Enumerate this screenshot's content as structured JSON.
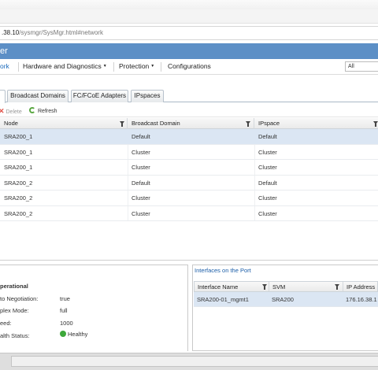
{
  "browser": {
    "url_host": ".38.10",
    "url_path": "/sysmgr/SysMgr.html#network"
  },
  "app": {
    "title": "er"
  },
  "menu": {
    "items": [
      {
        "label": "ork"
      },
      {
        "label": "Hardware and Diagnostics",
        "caret": "▼"
      },
      {
        "label": "Protection",
        "caret": "▼"
      },
      {
        "label": "Configurations"
      }
    ],
    "search_value": "All"
  },
  "tabs": [
    {
      "label": "Broadcast Domains"
    },
    {
      "label": "FC/FCoE Adapters"
    },
    {
      "label": "IPspaces"
    }
  ],
  "toolbar": {
    "delete_label": "Delete",
    "refresh_label": "Refresh"
  },
  "grid": {
    "columns": [
      "Node",
      "Broadcast Domain",
      "IPspace"
    ],
    "rows": [
      [
        "SRA200_1",
        "Default",
        "Default"
      ],
      [
        "SRA200_1",
        "Cluster",
        "Cluster"
      ],
      [
        "SRA200_1",
        "Cluster",
        "Cluster"
      ],
      [
        "SRA200_2",
        "Default",
        "Default"
      ],
      [
        "SRA200_2",
        "Cluster",
        "Cluster"
      ],
      [
        "SRA200_2",
        "Cluster",
        "Cluster"
      ]
    ]
  },
  "details": {
    "title": "perational",
    "fields": [
      {
        "label": "to Negotiation:",
        "value": "true"
      },
      {
        "label": "plex Mode:",
        "value": "full"
      },
      {
        "label": "eed:",
        "value": "1000"
      },
      {
        "label": "alth Status:",
        "value": "Healthy"
      }
    ],
    "health_color": "#3da83a"
  },
  "interfaces": {
    "title": "Interfaces on the Port",
    "columns": [
      "Interface Name",
      "SVM",
      "IP Address"
    ],
    "rows": [
      [
        "SRA200-01_mgmt1",
        "SRA200",
        "176.16.38.1"
      ]
    ]
  },
  "colors": {
    "title_bar": "#5c8fc6",
    "selected_row": "#dbe6f3",
    "active_menu": "#1c6bbd"
  }
}
